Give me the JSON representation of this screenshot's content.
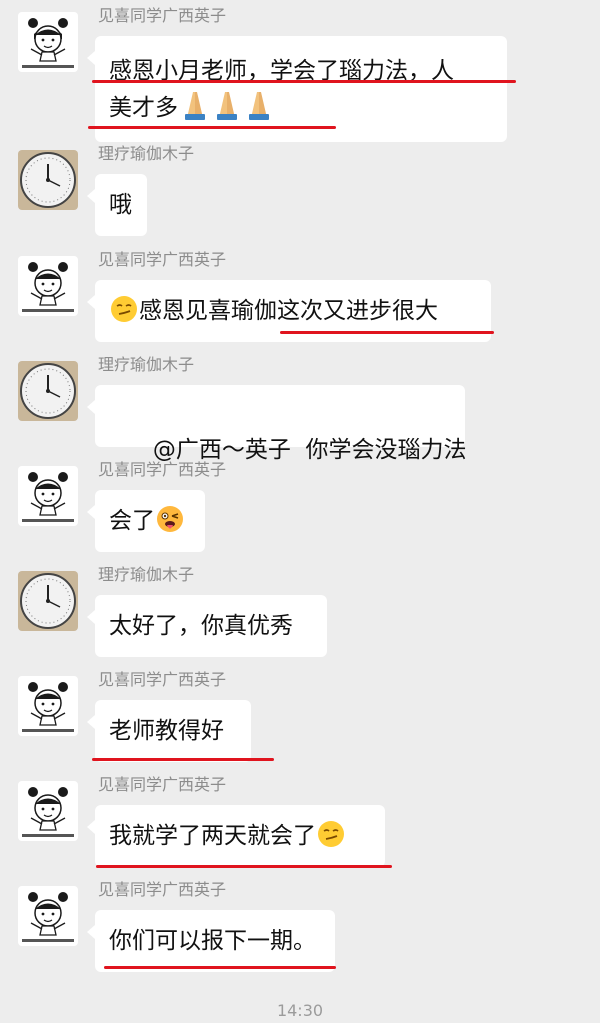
{
  "conversation": {
    "time_separator": "14:30",
    "messages": [
      {
        "sender": "见喜同学广西英子",
        "line1": "感恩小月老师，学会了瑙力法，人",
        "line2": "美才多"
      },
      {
        "sender": "理疗瑜伽木子",
        "text": "哦"
      },
      {
        "sender": "见喜同学广西英子",
        "text": "感恩见喜瑜伽这次又进步很大"
      },
      {
        "sender": "理疗瑜伽木子",
        "text": "@广西～英子  你学会没瑙力法"
      },
      {
        "sender": "见喜同学广西英子",
        "text": "会了"
      },
      {
        "sender": "理疗瑜伽木子",
        "text": "太好了，你真优秀"
      },
      {
        "sender": "见喜同学广西英子",
        "text": "老师教得好"
      },
      {
        "sender": "见喜同学广西英子",
        "text": "我就学了两天就会了"
      },
      {
        "sender": "见喜同学广西英子",
        "text": "你们可以报下一期。"
      }
    ]
  },
  "emoji": {
    "praying_hands": "praying-hands-icon",
    "smirk": "smirk-face-icon",
    "tongue_wink": "tongue-wink-face-icon"
  },
  "colors": {
    "background": "#ededed",
    "bubble": "#ffffff",
    "underline": "#e0141e",
    "sender_name": "#8c8c8c"
  }
}
